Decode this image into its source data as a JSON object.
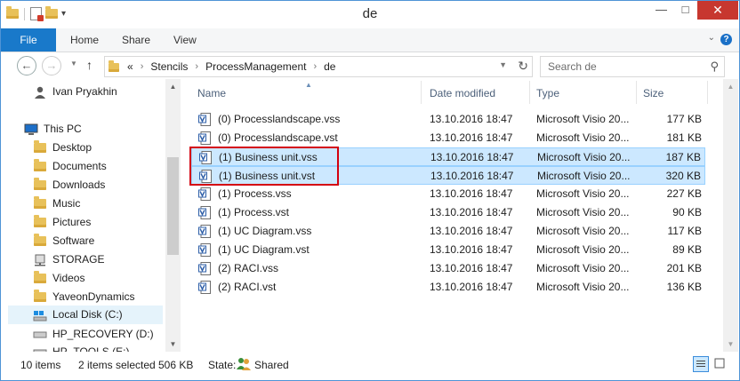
{
  "window": {
    "title": "de"
  },
  "ribbon": {
    "tabs": [
      {
        "label": "File"
      },
      {
        "label": "Home"
      },
      {
        "label": "Share"
      },
      {
        "label": "View"
      }
    ]
  },
  "address": {
    "overflow": "«",
    "crumbs": [
      {
        "label": "Stencils"
      },
      {
        "label": "ProcessManagement"
      },
      {
        "label": "de"
      }
    ]
  },
  "search": {
    "placeholder": "Search de"
  },
  "nav": {
    "items": [
      {
        "label": "Ivan Pryakhin",
        "icon": "user-icon"
      },
      {
        "label": "This PC",
        "icon": "computer-icon"
      },
      {
        "label": "Desktop",
        "icon": "folder-icon"
      },
      {
        "label": "Documents",
        "icon": "folder-icon"
      },
      {
        "label": "Downloads",
        "icon": "folder-icon"
      },
      {
        "label": "Music",
        "icon": "folder-icon"
      },
      {
        "label": "Pictures",
        "icon": "folder-icon"
      },
      {
        "label": "Software",
        "icon": "folder-icon"
      },
      {
        "label": "STORAGE",
        "icon": "network-drive-icon"
      },
      {
        "label": "Videos",
        "icon": "folder-icon"
      },
      {
        "label": "YaveonDynamics",
        "icon": "folder-icon"
      },
      {
        "label": "Local Disk (C:)",
        "icon": "local-disk-icon",
        "selected": true
      },
      {
        "label": "HP_RECOVERY (D:)",
        "icon": "drive-icon"
      },
      {
        "label": "HP_TOOLS (E:)",
        "icon": "drive-icon"
      }
    ]
  },
  "columns": {
    "name": "Name",
    "date": "Date modified",
    "type": "Type",
    "size": "Size"
  },
  "files": [
    {
      "name": "(0) Processlandscape.vss",
      "date": "13.10.2016 18:47",
      "type": "Microsoft Visio 20...",
      "size": "177 KB",
      "selected": false
    },
    {
      "name": "(0) Processlandscape.vst",
      "date": "13.10.2016 18:47",
      "type": "Microsoft Visio 20...",
      "size": "181 KB",
      "selected": false
    },
    {
      "name": "(1) Business unit.vss",
      "date": "13.10.2016 18:47",
      "type": "Microsoft Visio 20...",
      "size": "187 KB",
      "selected": true
    },
    {
      "name": "(1) Business unit.vst",
      "date": "13.10.2016 18:47",
      "type": "Microsoft Visio 20...",
      "size": "320 KB",
      "selected": true
    },
    {
      "name": "(1) Process.vss",
      "date": "13.10.2016 18:47",
      "type": "Microsoft Visio 20...",
      "size": "227 KB",
      "selected": false
    },
    {
      "name": "(1) Process.vst",
      "date": "13.10.2016 18:47",
      "type": "Microsoft Visio 20...",
      "size": "90 KB",
      "selected": false
    },
    {
      "name": "(1) UC Diagram.vss",
      "date": "13.10.2016 18:47",
      "type": "Microsoft Visio 20...",
      "size": "117 KB",
      "selected": false
    },
    {
      "name": "(1) UC Diagram.vst",
      "date": "13.10.2016 18:47",
      "type": "Microsoft Visio 20...",
      "size": "89 KB",
      "selected": false
    },
    {
      "name": "(2) RACI.vss",
      "date": "13.10.2016 18:47",
      "type": "Microsoft Visio 20...",
      "size": "201 KB",
      "selected": false
    },
    {
      "name": "(2) RACI.vst",
      "date": "13.10.2016 18:47",
      "type": "Microsoft Visio 20...",
      "size": "136 KB",
      "selected": false
    }
  ],
  "status": {
    "item_count": "10 items",
    "selected": "2 items selected",
    "size": "506 KB",
    "state_label": "State:",
    "state_value": "Shared"
  },
  "colors": {
    "accent": "#1979ca",
    "selection": "#cce8ff",
    "highlight_box": "#d4000f"
  }
}
